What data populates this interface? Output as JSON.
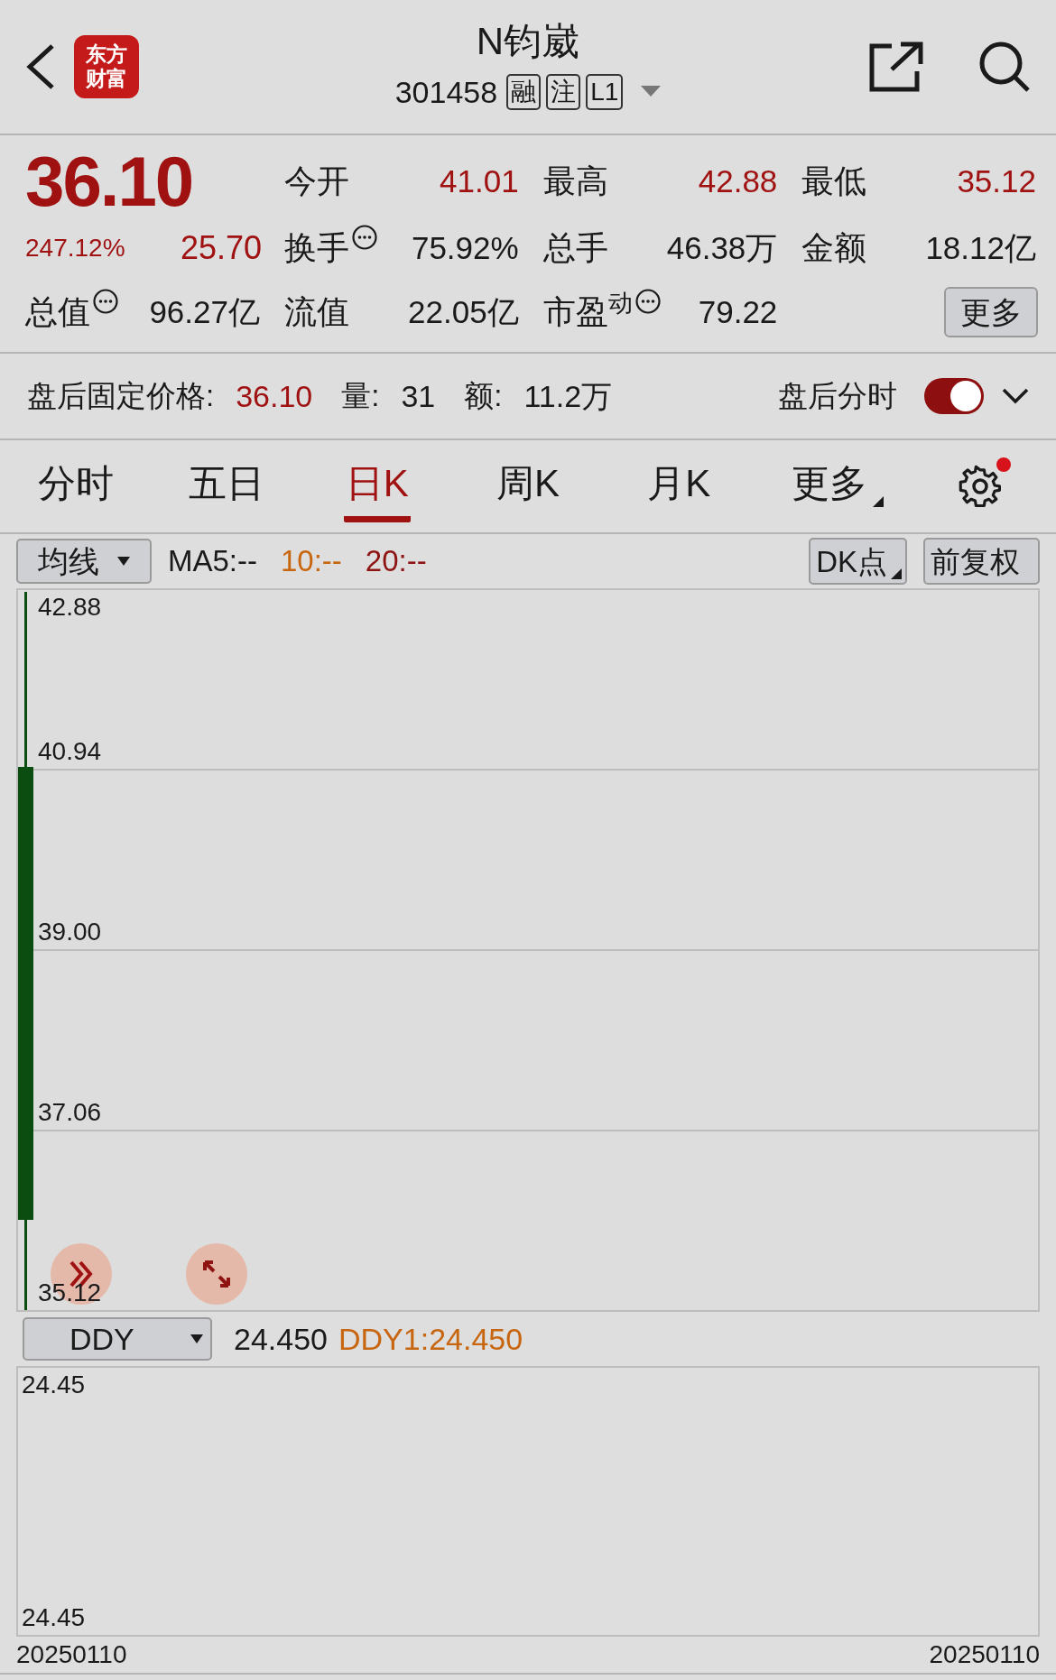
{
  "header": {
    "logo_text": [
      "东方",
      "财富"
    ],
    "title": "N钧崴",
    "code": "301458",
    "badges": [
      "融",
      "注",
      "L1"
    ]
  },
  "quote": {
    "price": "36.10",
    "change_pct": "247.12%",
    "change": "25.70",
    "stats": [
      {
        "label": "今开",
        "value": "41.01",
        "up": true,
        "info": false
      },
      {
        "label": "最高",
        "value": "42.88",
        "up": true,
        "info": false
      },
      {
        "label": "最低",
        "value": "35.12",
        "up": true,
        "info": false
      },
      {
        "label": "换手",
        "value": "75.92%",
        "up": false,
        "info": true
      },
      {
        "label": "总手",
        "value": "46.38万",
        "up": false,
        "info": false
      },
      {
        "label": "金额",
        "value": "18.12亿",
        "up": false,
        "info": false
      },
      {
        "label": "总值",
        "value": "96.27亿",
        "up": false,
        "info": true
      },
      {
        "label": "流值",
        "value": "22.05亿",
        "up": false,
        "info": false
      },
      {
        "label": "市盈$^{动}$",
        "value": "79.22",
        "up": false,
        "info": true
      }
    ],
    "more_button": "更多"
  },
  "after_hours": {
    "items": [
      {
        "label": "盘后固定价格:",
        "value": "36.10",
        "up": true
      },
      {
        "label": "量:",
        "value": "31",
        "up": false
      },
      {
        "label": "额:",
        "value": "11.2万",
        "up": false
      }
    ],
    "toggle_label": "盘后分时",
    "toggle_on": true
  },
  "tabs": [
    {
      "label": "分时",
      "selected": false,
      "menu": false
    },
    {
      "label": "五日",
      "selected": false,
      "menu": false
    },
    {
      "label": "日K",
      "selected": true,
      "menu": false
    },
    {
      "label": "周K",
      "selected": false,
      "menu": false
    },
    {
      "label": "月K",
      "selected": false,
      "menu": false
    },
    {
      "label": "更多",
      "selected": false,
      "menu": true
    }
  ],
  "settings_badge": true,
  "toolbar": {
    "indicator": "均线",
    "legend": [
      {
        "text": "MA5:--",
        "color": "#1a1a1a"
      },
      {
        "text": "10:--",
        "color": "#c8650f"
      },
      {
        "text": "20:--",
        "color": "#8e1414"
      }
    ],
    "buttons": [
      {
        "label": "DK点",
        "menu": true
      },
      {
        "label": "前复权",
        "menu": false
      }
    ]
  },
  "main_chart": {
    "axis_labels": [
      "42.88",
      "40.94",
      "39.00",
      "37.06",
      "35.12"
    ]
  },
  "sub_toolbar": {
    "indicator": "DDY",
    "value": "24.450",
    "legend": [
      {
        "text": "DDY1:24.450",
        "color": "#c8650f"
      }
    ]
  },
  "sub_chart": {
    "axis_labels": [
      "24.45",
      "24.45"
    ]
  },
  "dates": [
    "20250110",
    "20250110"
  ]
}
